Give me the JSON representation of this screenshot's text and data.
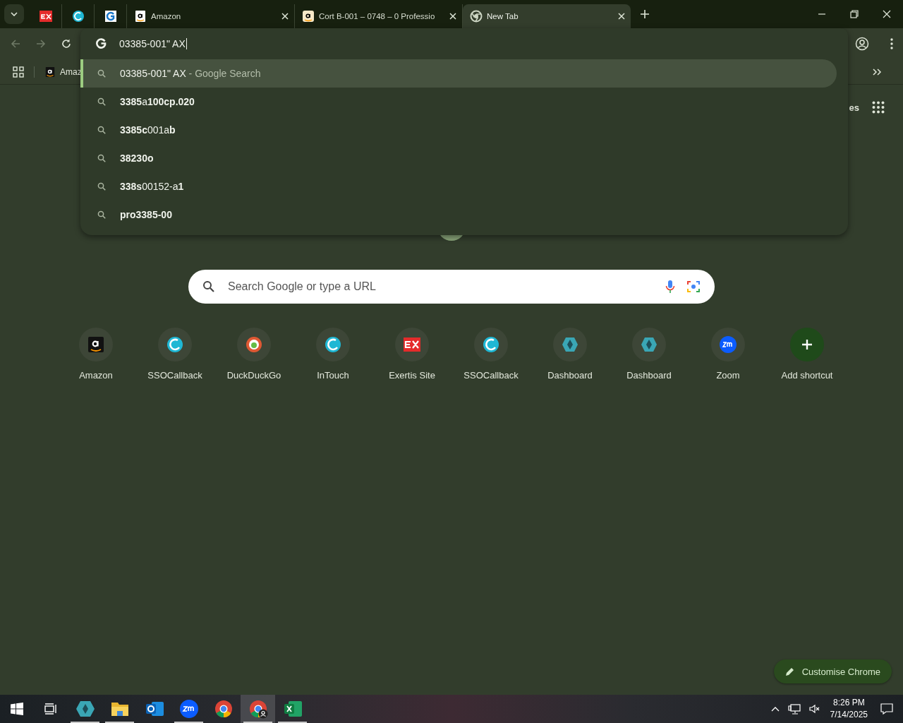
{
  "tabs": [
    {
      "kind": "ex",
      "selected": false
    },
    {
      "kind": "swirl",
      "selected": false
    },
    {
      "kind": "g",
      "selected": false
    },
    {
      "kind": "amazon",
      "title": "Amazon",
      "selected": false
    },
    {
      "kind": "amazon-box",
      "title": "Cort B-001 – 0748 – 0 Professio",
      "selected": false
    },
    {
      "kind": "chrome",
      "title": "New Tab",
      "selected": true
    }
  ],
  "omnibox": {
    "value": "03385-001\" AX"
  },
  "suggestions": [
    {
      "text": "03385-001\" AX",
      "suffix": " - Google Search",
      "selected": true
    },
    {
      "text": "**3385**a**100cp.020**",
      "selected": false
    },
    {
      "text": "**3385c**001a**b**",
      "selected": false
    },
    {
      "text": "**38230o**",
      "selected": false
    },
    {
      "text": "**338s**00152-a**1**",
      "selected": false
    },
    {
      "text": "**pro3385-00**",
      "selected": false
    }
  ],
  "bookmarks": [
    {
      "kind": "amazon",
      "label": "Amaz"
    }
  ],
  "top_links": {
    "partial": "es"
  },
  "search": {
    "placeholder": "Search Google or type a URL"
  },
  "shortcuts": [
    {
      "kind": "amazon",
      "label": "Amazon"
    },
    {
      "kind": "swirl",
      "label": "SSOCallback"
    },
    {
      "kind": "duck",
      "label": "DuckDuckGo"
    },
    {
      "kind": "swirl",
      "label": "InTouch"
    },
    {
      "kind": "ex",
      "label": "Exertis Site"
    },
    {
      "kind": "swirl",
      "label": "SSOCallback"
    },
    {
      "kind": "diamond",
      "label": "Dashboard"
    },
    {
      "kind": "diamond",
      "label": "Dashboard"
    },
    {
      "kind": "zoom",
      "label": "Zoom"
    },
    {
      "kind": "add",
      "label": "Add shortcut"
    }
  ],
  "customise_button": {
    "label": "Customise Chrome"
  },
  "taskbar": {
    "apps": [
      {
        "kind": "diamond",
        "running": true,
        "selected": false
      },
      {
        "kind": "folder",
        "running": true,
        "selected": false
      },
      {
        "kind": "outlook",
        "running": false,
        "selected": false
      },
      {
        "kind": "zoom",
        "running": true,
        "selected": false
      },
      {
        "kind": "chrome",
        "running": false,
        "selected": false
      },
      {
        "kind": "chrome-profile",
        "running": true,
        "selected": true
      },
      {
        "kind": "excel",
        "running": true,
        "selected": false
      }
    ],
    "time": "8:26 PM",
    "date": "7/14/2025"
  }
}
